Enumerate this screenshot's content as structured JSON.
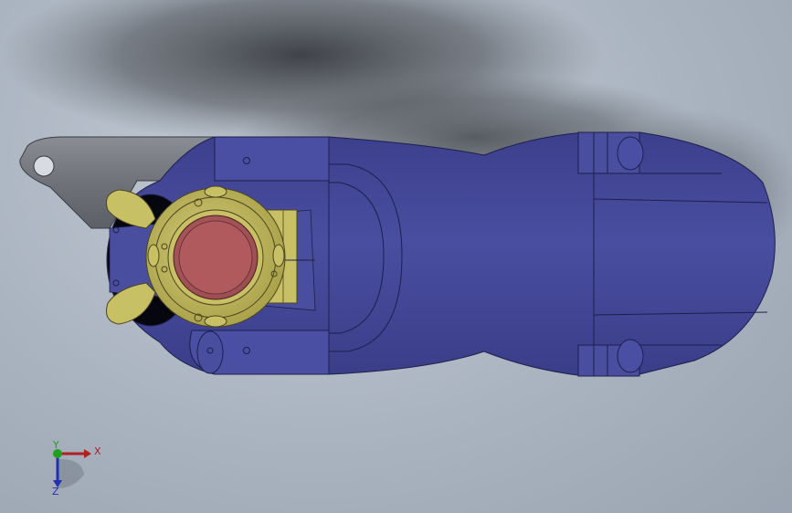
{
  "viewport": {
    "background_color": "#a9b3bf",
    "model": {
      "body_color": "#474a9a",
      "body_edge_color": "#1d1f4a",
      "handle_color": "#75787f",
      "fitting_color": "#c8c064",
      "cap_color": "#b05a5e"
    }
  },
  "triad": {
    "x_label": "X",
    "y_label": "Y",
    "z_label": "Z",
    "x_color": "#b02020",
    "y_color": "#20a020",
    "z_color": "#2030b0"
  }
}
